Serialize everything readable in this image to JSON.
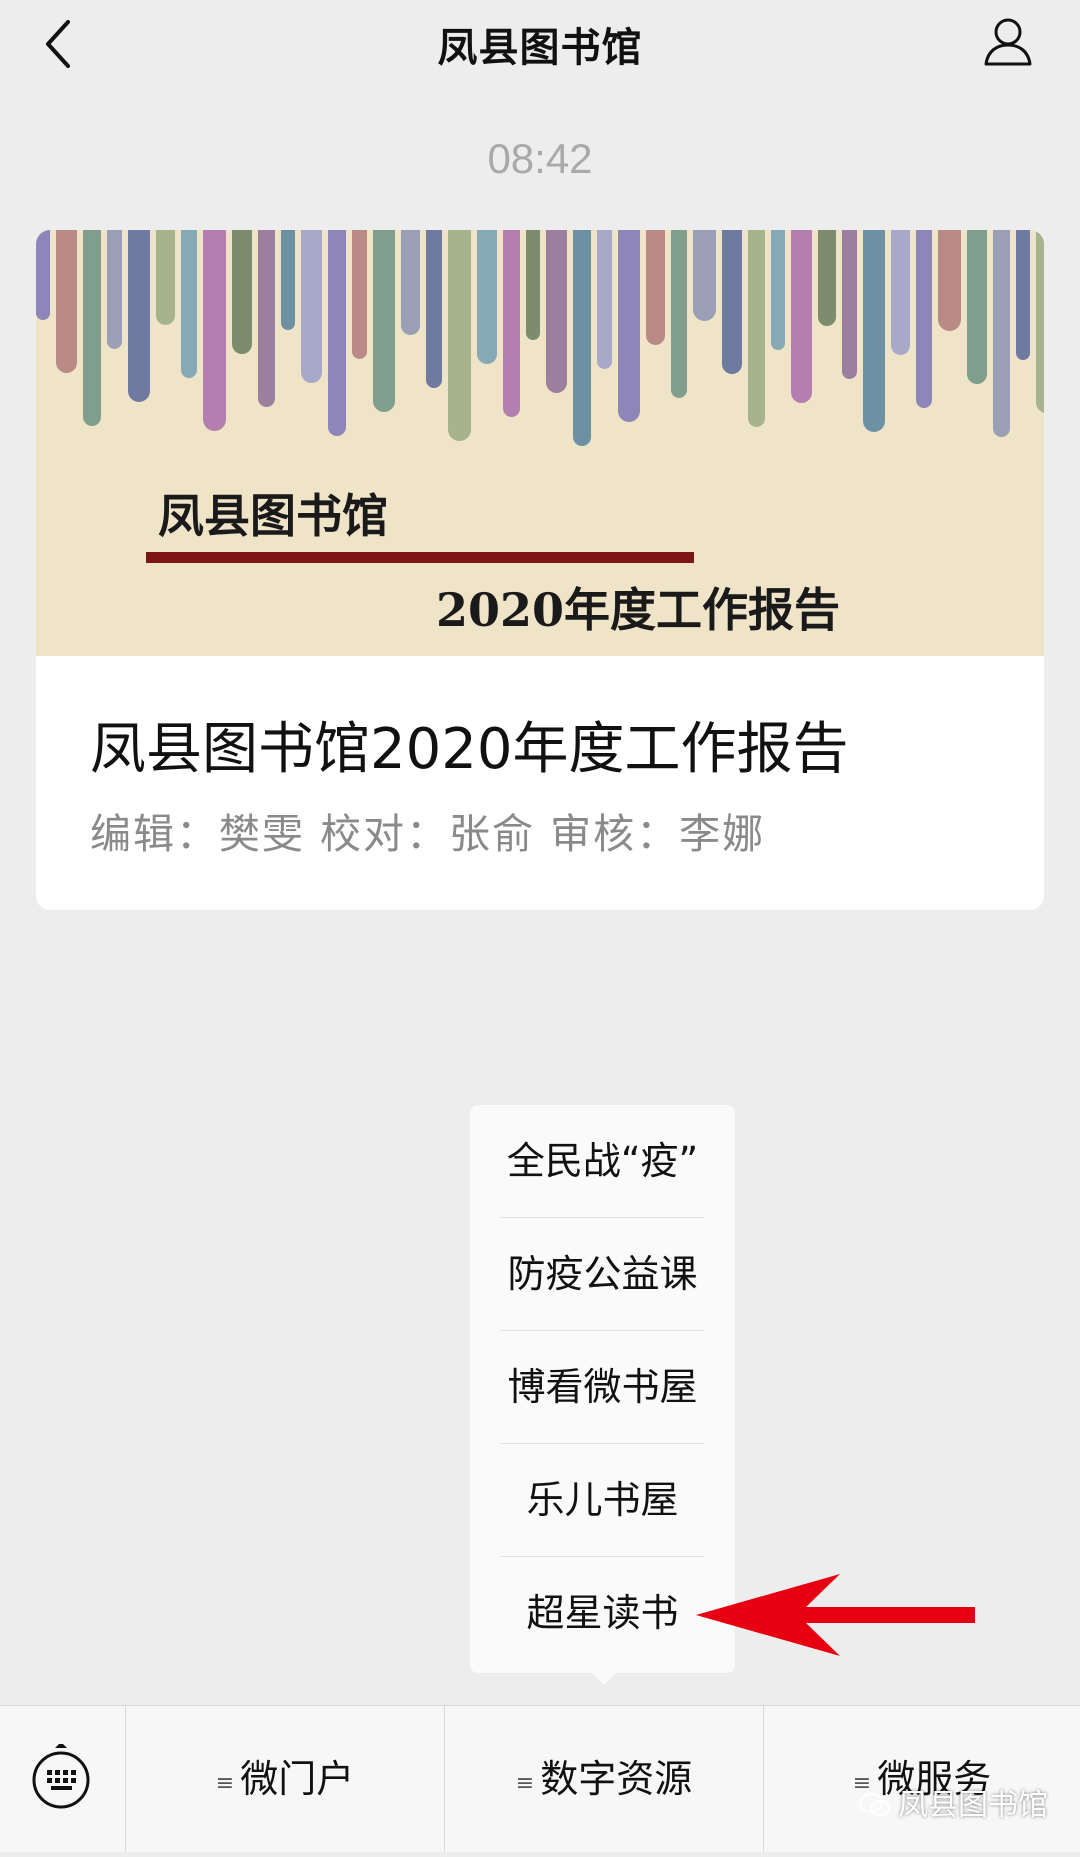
{
  "header": {
    "title": "凤县图书馆"
  },
  "chat": {
    "timestamp": "08:42"
  },
  "article": {
    "cover_title": "凤县图书馆",
    "cover_subtitle": "2020年度工作报告",
    "title": "凤县图书馆2020年度工作报告",
    "meta": "编辑：樊雯 校对：张俞 审核：李娜",
    "accent_color": "#7c1414"
  },
  "submenu": {
    "items": [
      "全民战“疫”",
      "防疫公益课",
      "博看微书屋",
      "乐儿书屋",
      "超星读书"
    ],
    "highlight_color": "#e60012"
  },
  "bottom_menu": {
    "keyboard_icon": "keyboard-icon",
    "items": [
      "微门户",
      "数字资源",
      "微服务"
    ]
  },
  "watermark": {
    "text": "凤县图书馆"
  }
}
